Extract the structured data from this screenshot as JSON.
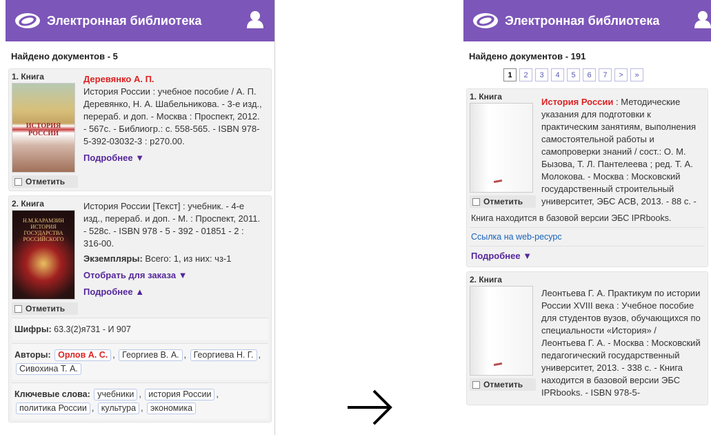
{
  "app_title": "Электронная библиотека",
  "left": {
    "found": "Найдено документов - 5",
    "cards": [
      {
        "label": "1. Книга",
        "cover_text": "ИСТОРИЯ РОССИИ",
        "author": "Деревянко А. П.",
        "description": "История России : учебное пособие / А. П. Деревянко, Н. А. Шабельникова. - 3-е изд., перераб. и доп. - Москва : Проспект, 2012. - 567с. - Библиогр.: с. 558-565. - ISBN 978-5-392-03032-3 : р270.00.",
        "mark": "Отметить",
        "more": "Подробнее ▼"
      },
      {
        "label": "2. Книга",
        "cover_text": "Н.М.КАРАМЗИН ИСТОРИЯ ГОСУДАРСТВА РОССИЙСКОГО",
        "description": "История России [Текст] : учебник. - 4-е изд., перераб. и доп. - М. : Проспект, 2011. - 528с. - ISBN 978 - 5 - 392 - 01851 - 2 : 316-00.",
        "copies_label": "Экземпляры:",
        "copies_value": " Всего: 1, из них: чз-1",
        "order": "Отобрать для заказа ▼",
        "mark": "Отметить",
        "more": "Подробнее ▲",
        "codes_label": "Шифры:",
        "codes_value": " 63.3(2)я731 - И 907",
        "authors_label": "Авторы:",
        "authors": [
          "Орлов А. С.",
          "Георгиев В. А.",
          "Георгиева Н. Г.",
          "Сивохина Т. А."
        ],
        "keywords_label": "Ключевые слова:",
        "keywords": [
          "учебники",
          "история России",
          "политика России",
          "культура",
          "экономика"
        ]
      }
    ]
  },
  "right": {
    "found": "Найдено документов - 191",
    "pages": [
      "1",
      "2",
      "3",
      "4",
      "5",
      "6",
      "7",
      ">",
      "»"
    ],
    "cards": [
      {
        "label": "1. Книга",
        "title_red": "История России",
        "description": " : Методические указания для подготовки к практическим занятиям, выполнения самостоятельной работы и самопроверки знаний / сост.: О. М. Бызова, Т. Л. Пантелеева ; ред. Т. А. Молокова. - Москва : Московский государственный строительный университет, ЭБС АСВ, 2013. - 88 с. -",
        "extra": "Книга находится в базовой версии ЭБС IPRbooks.",
        "web_link": "Ссылка на web-ресурс",
        "mark": "Отметить",
        "more": "Подробнее ▼"
      },
      {
        "label": "2. Книга",
        "description": "Леонтьева Г. А. Практикум по истории России XVIII века : Учебное пособие для студентов вузов, обучающихся по специальности «История» / Леонтьева Г. А. - Москва : Московский педагогический государственный университет, 2013. - 338 с. - Книга находится в базовой версии ЭБС IPRbooks. - ISBN 978-5-",
        "mark": "Отметить"
      }
    ]
  }
}
